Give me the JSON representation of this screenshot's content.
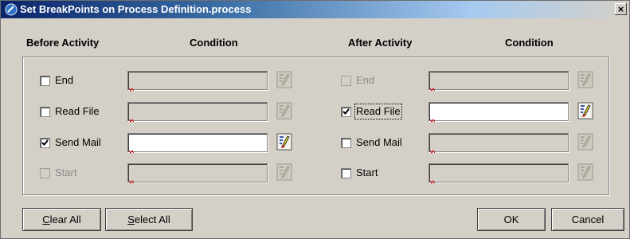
{
  "window": {
    "title": "Set BreakPoints on Process Definition.process",
    "close_label": "×"
  },
  "headers": {
    "before_activity": "Before Activity",
    "before_condition": "Condition",
    "after_activity": "After Activity",
    "after_condition": "Condition"
  },
  "before": [
    {
      "label": "End",
      "checked": false,
      "enabled": true
    },
    {
      "label": "Read File",
      "checked": false,
      "enabled": true
    },
    {
      "label": "Send Mail",
      "checked": true,
      "enabled": true
    },
    {
      "label": "Start",
      "checked": false,
      "enabled": false
    }
  ],
  "after": [
    {
      "label": "End",
      "checked": false,
      "enabled": false
    },
    {
      "label": "Read File",
      "checked": true,
      "enabled": true
    },
    {
      "label": "Send Mail",
      "checked": false,
      "enabled": true
    },
    {
      "label": "Start",
      "checked": false,
      "enabled": true
    }
  ],
  "buttons": {
    "clear_all_mnemonic": "C",
    "clear_all_rest": "lear All",
    "select_all_mnemonic": "S",
    "select_all_rest": "elect All",
    "ok": "OK",
    "cancel": "Cancel"
  },
  "icons": {
    "title": "app-icon",
    "edit": "edit-condition-icon",
    "check": "checkmark-icon"
  }
}
